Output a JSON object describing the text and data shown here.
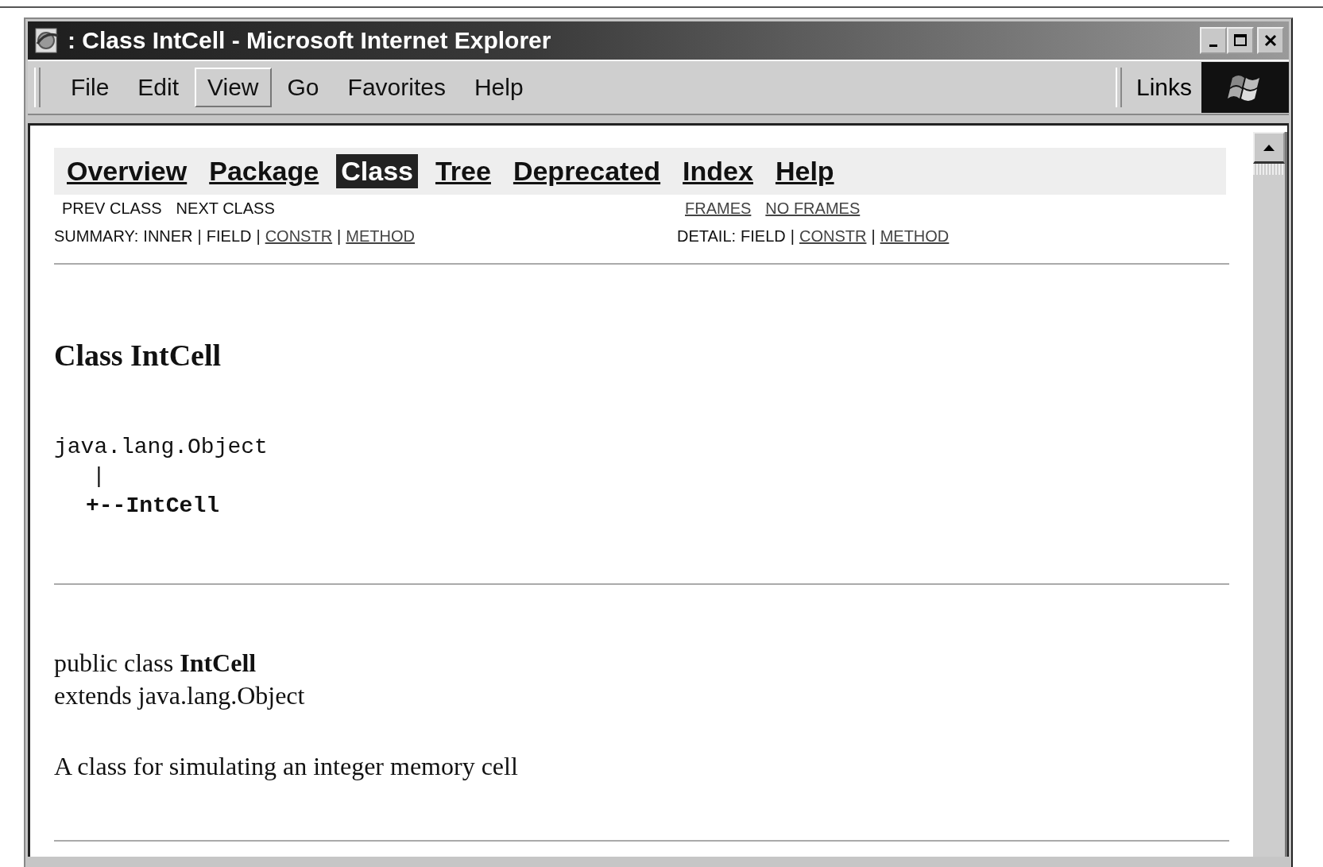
{
  "window": {
    "title": ": Class IntCell - Microsoft Internet Explorer"
  },
  "menu": [
    {
      "label": "File",
      "selected": false
    },
    {
      "label": "Edit",
      "selected": false
    },
    {
      "label": "View",
      "selected": true
    },
    {
      "label": "Go",
      "selected": false
    },
    {
      "label": "Favorites",
      "selected": false
    },
    {
      "label": "Help",
      "selected": false
    }
  ],
  "links_label": "Links",
  "nav": [
    {
      "label": "Overview",
      "selected": false
    },
    {
      "label": "Package",
      "selected": false
    },
    {
      "label": "Class",
      "selected": true
    },
    {
      "label": "Tree",
      "selected": false
    },
    {
      "label": "Deprecated",
      "selected": false
    },
    {
      "label": "Index",
      "selected": false
    },
    {
      "label": "Help",
      "selected": false
    }
  ],
  "subnav_left": [
    {
      "label": "PREV CLASS",
      "link": false
    },
    {
      "label": "NEXT CLASS",
      "link": false
    }
  ],
  "subnav_right": [
    {
      "label": "FRAMES",
      "link": true
    },
    {
      "label": "NO FRAMES",
      "link": true
    }
  ],
  "summary": {
    "label": "SUMMARY:",
    "separator": "|",
    "items": [
      {
        "label": "INNER",
        "link": false
      },
      {
        "label": "FIELD",
        "link": false
      },
      {
        "label": "CONSTR",
        "link": true
      },
      {
        "label": "METHOD",
        "link": true
      }
    ]
  },
  "detail": {
    "label": "DETAIL:",
    "separator": "|",
    "items": [
      {
        "label": "FIELD",
        "link": false
      },
      {
        "label": "CONSTR",
        "link": true
      },
      {
        "label": "METHOD",
        "link": true
      }
    ]
  },
  "heading": "Class IntCell",
  "hierarchy": {
    "parent": "java.lang.Object",
    "connector": "|",
    "child": "+--IntCell"
  },
  "declaration": [
    "public class **IntCell**",
    "extends java.lang.Object"
  ],
  "description": "A class for simulating an integer memory cell"
}
